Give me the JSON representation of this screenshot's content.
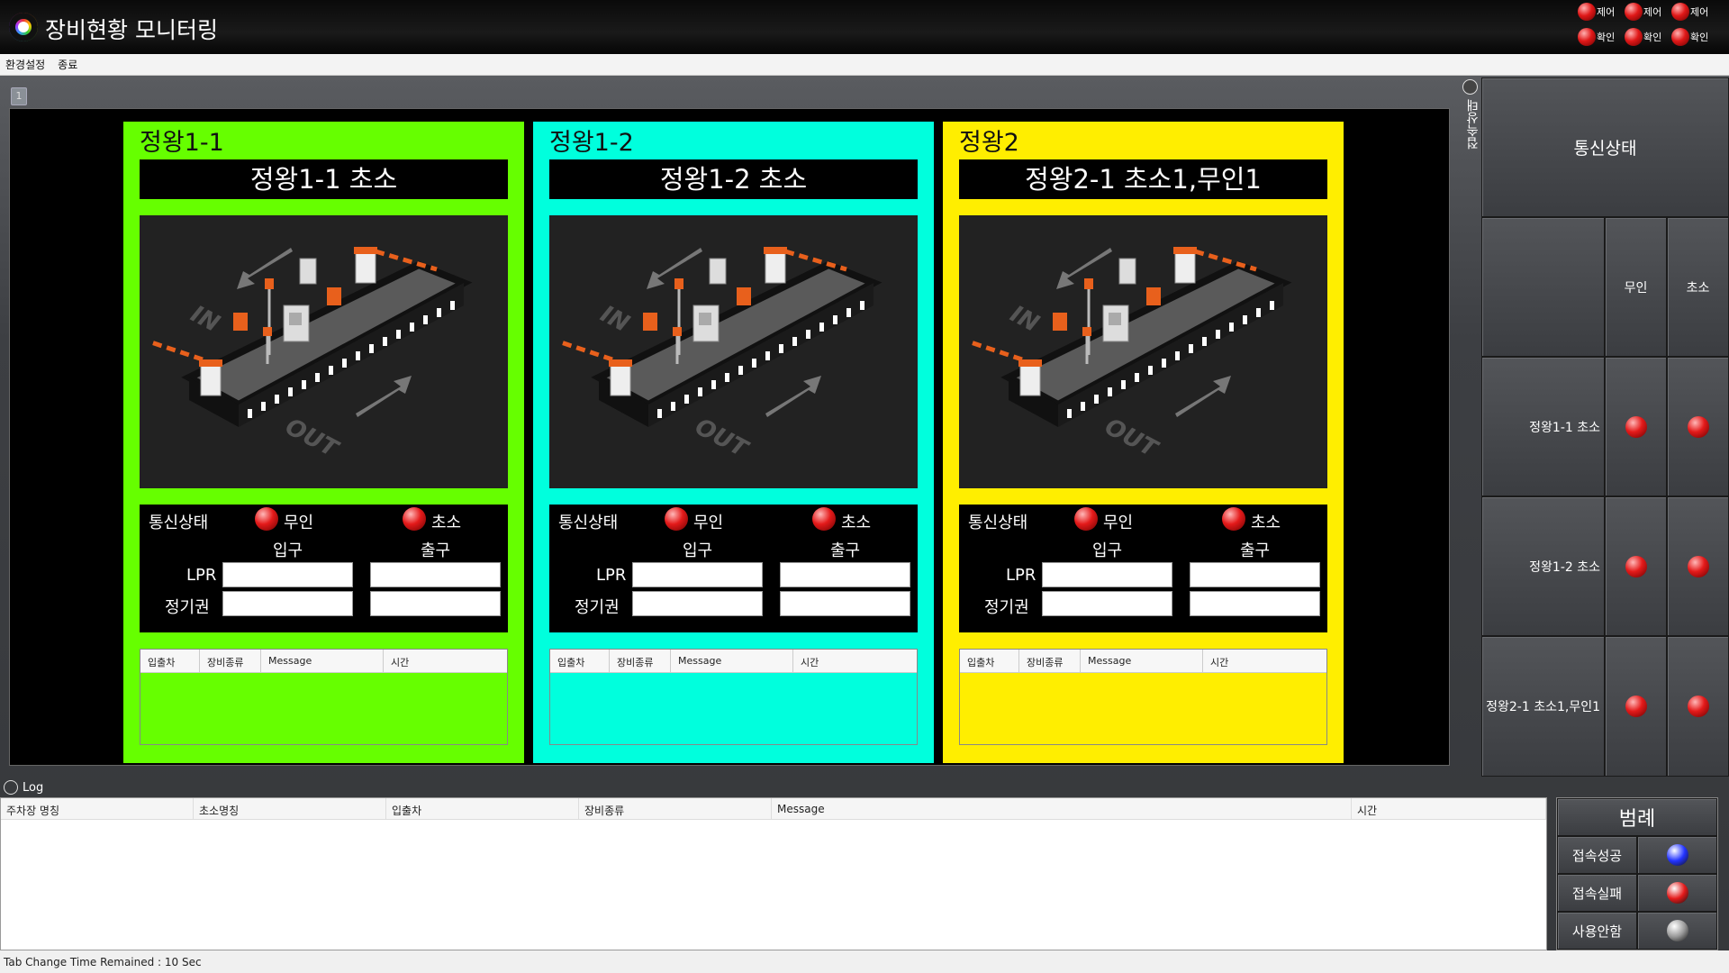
{
  "window": {
    "title": "장비현황 모니터링"
  },
  "controls": [
    {
      "label": "제어"
    },
    {
      "label": "제어"
    },
    {
      "label": "제어"
    },
    {
      "label": "확인"
    },
    {
      "label": "확인"
    },
    {
      "label": "확인"
    }
  ],
  "menu": {
    "items": [
      "환경설정",
      "종료"
    ]
  },
  "tab": {
    "marker": "1"
  },
  "panels": [
    {
      "name": "정왕1-1",
      "banner": "정왕1-1 초소",
      "color": "#66ff00",
      "status_label": "통신상태",
      "unmanned_label": "무인",
      "post_label": "초소",
      "entry_label": "입구",
      "exit_label": "출구",
      "lpr_label": "LPR",
      "pass_label": "정기권",
      "log_cols": [
        "입출차",
        "장비종류",
        "Message",
        "시간"
      ]
    },
    {
      "name": "정왕1-2",
      "banner": "정왕1-2 초소",
      "color": "#00ffdd",
      "status_label": "통신상태",
      "unmanned_label": "무인",
      "post_label": "초소",
      "entry_label": "입구",
      "exit_label": "출구",
      "lpr_label": "LPR",
      "pass_label": "정기권",
      "log_cols": [
        "입출차",
        "장비종류",
        "Message",
        "시간"
      ]
    },
    {
      "name": "정왕2",
      "banner": "정왕2-1 초소1,무인1",
      "color": "#ffee00",
      "status_label": "통신상태",
      "unmanned_label": "무인",
      "post_label": "초소",
      "entry_label": "입구",
      "exit_label": "출구",
      "lpr_label": "LPR",
      "pass_label": "정기권",
      "log_cols": [
        "입출차",
        "장비종류",
        "Message",
        "시간"
      ]
    }
  ],
  "comm": {
    "vertical_label": "접속상태",
    "title": "통신상태",
    "col_unmanned": "무인",
    "col_post": "초소",
    "rows": [
      "정왕1-1 초소",
      "정왕1-2 초소",
      "정왕2-1 초소1,무인1"
    ]
  },
  "log": {
    "label": "Log",
    "columns": [
      "주차장 명칭",
      "초소명칭",
      "입출차",
      "장비종류",
      "Message",
      "시간"
    ]
  },
  "legend": {
    "title": "범례",
    "items": [
      {
        "label": "접속성공",
        "color": "#2233ff"
      },
      {
        "label": "접속실패",
        "color": "#e41a1a"
      },
      {
        "label": "사용안함",
        "color": "#9a9a9a"
      }
    ]
  },
  "status": {
    "text": "Tab Change Time Remained : 10 Sec"
  }
}
